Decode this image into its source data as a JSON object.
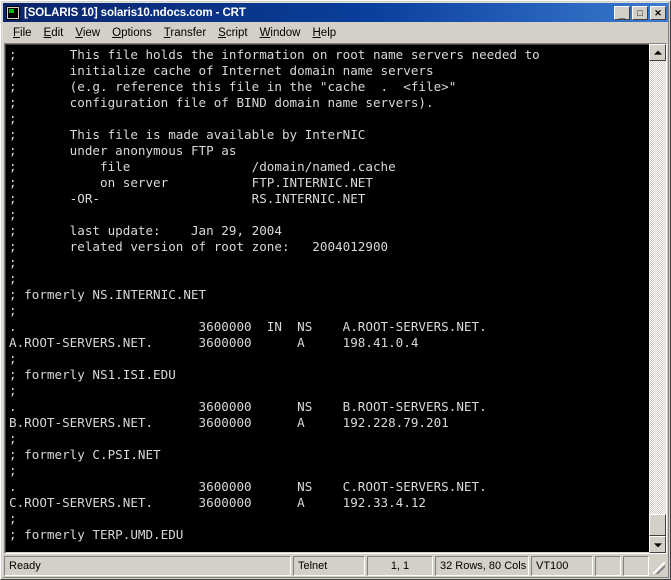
{
  "window": {
    "title": "[SOLARIS 10] solaris10.ndocs.com - CRT",
    "icon": "terminal-icon",
    "minimize_label": "_",
    "maximize_label": "□",
    "close_label": "✕"
  },
  "menu": {
    "items": [
      {
        "label": "File",
        "accel": "F"
      },
      {
        "label": "Edit",
        "accel": "E"
      },
      {
        "label": "View",
        "accel": "V"
      },
      {
        "label": "Options",
        "accel": "O"
      },
      {
        "label": "Transfer",
        "accel": "T"
      },
      {
        "label": "Script",
        "accel": "S"
      },
      {
        "label": "Window",
        "accel": "W"
      },
      {
        "label": "Help",
        "accel": "H"
      }
    ]
  },
  "terminal": {
    "foreground_color": "#d8d8d8",
    "background_color": "#000000",
    "lines": [
      ";       This file holds the information on root name servers needed to",
      ";       initialize cache of Internet domain name servers",
      ";       (e.g. reference this file in the \"cache  .  <file>\"",
      ";       configuration file of BIND domain name servers).",
      ";",
      ";       This file is made available by InterNIC",
      ";       under anonymous FTP as",
      ";           file                /domain/named.cache",
      ";           on server           FTP.INTERNIC.NET",
      ";       -OR-                    RS.INTERNIC.NET",
      ";",
      ";       last update:    Jan 29, 2004",
      ";       related version of root zone:   2004012900",
      ";",
      ";",
      "; formerly NS.INTERNIC.NET",
      ";",
      ".                        3600000  IN  NS    A.ROOT-SERVERS.NET.",
      "A.ROOT-SERVERS.NET.      3600000      A     198.41.0.4",
      ";",
      "; formerly NS1.ISI.EDU",
      ";",
      ".                        3600000      NS    B.ROOT-SERVERS.NET.",
      "B.ROOT-SERVERS.NET.      3600000      A     192.228.79.201",
      ";",
      "; formerly C.PSI.NET",
      ";",
      ".                        3600000      NS    C.ROOT-SERVERS.NET.",
      "C.ROOT-SERVERS.NET.      3600000      A     192.33.4.12",
      ";",
      "; formerly TERP.UMD.EDU"
    ]
  },
  "scrollbar": {
    "up_arrow": "scroll-up-arrow",
    "down_arrow": "scroll-down-arrow"
  },
  "status_bar": {
    "message": "Ready",
    "protocol": "Telnet",
    "cursor_position": "1,  1",
    "dimensions": "32 Rows, 80 Cols",
    "emulation": "VT100",
    "extra_1": "",
    "extra_2": ""
  }
}
